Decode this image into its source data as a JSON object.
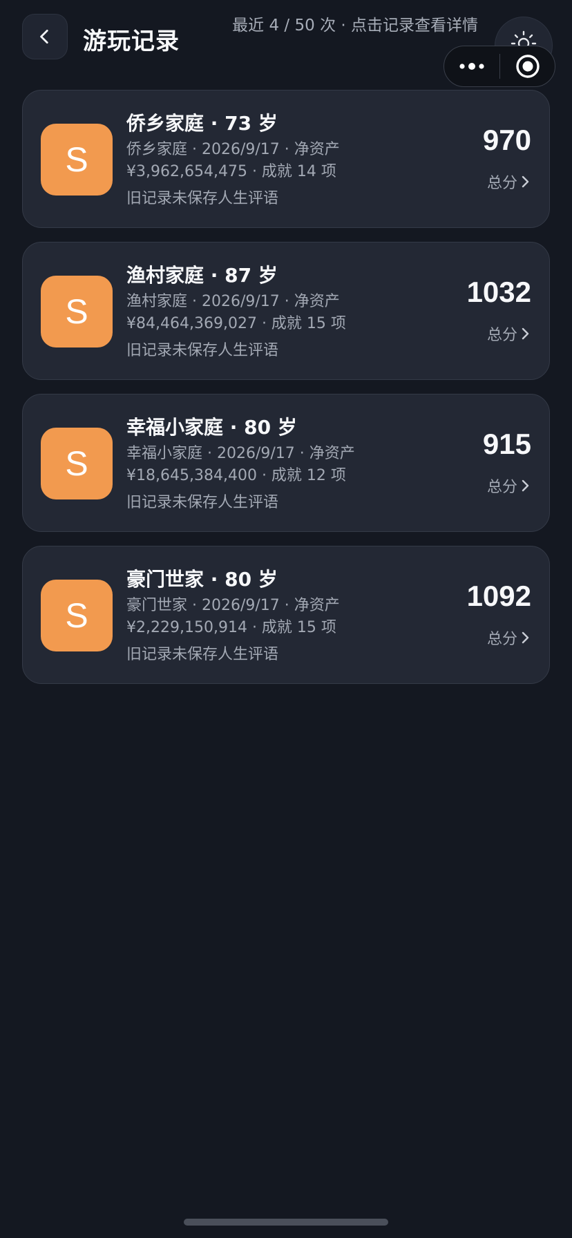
{
  "header": {
    "title": "游玩记录",
    "subtitle": "最近 4 / 50 次 · 点击记录查看详情",
    "back_icon": "chevron-left-icon",
    "theme_icon": "sun-icon"
  },
  "capsule": {
    "more_icon": "more-dots-icon",
    "close_icon": "target-close-icon"
  },
  "records": [
    {
      "avatar": "S",
      "title": "侨乡家庭 · 73 岁",
      "desc": "侨乡家庭 · 2026/9/17 · 净资产 ¥3,962,654,475 · 成就 14 项",
      "note": "旧记录未保存人生评语",
      "score": "970",
      "score_label": "总分"
    },
    {
      "avatar": "S",
      "title": "渔村家庭 · 87 岁",
      "desc": "渔村家庭 · 2026/9/17 · 净资产 ¥84,464,369,027 · 成就 15 项",
      "note": "旧记录未保存人生评语",
      "score": "1032",
      "score_label": "总分"
    },
    {
      "avatar": "S",
      "title": "幸福小家庭 · 80 岁",
      "desc": "幸福小家庭 · 2026/9/17 · 净资产 ¥18,645,384,400 · 成就 12 项",
      "note": "旧记录未保存人生评语",
      "score": "915",
      "score_label": "总分"
    },
    {
      "avatar": "S",
      "title": "豪门世家 · 80 岁",
      "desc": "豪门世家 · 2026/9/17 · 净资产 ¥2,229,150,914 · 成就 15 项",
      "note": "旧记录未保存人生评语",
      "score": "1092",
      "score_label": "总分"
    }
  ],
  "colors": {
    "background": "#141821",
    "card": "#232834",
    "accent": "#f29a4f"
  }
}
